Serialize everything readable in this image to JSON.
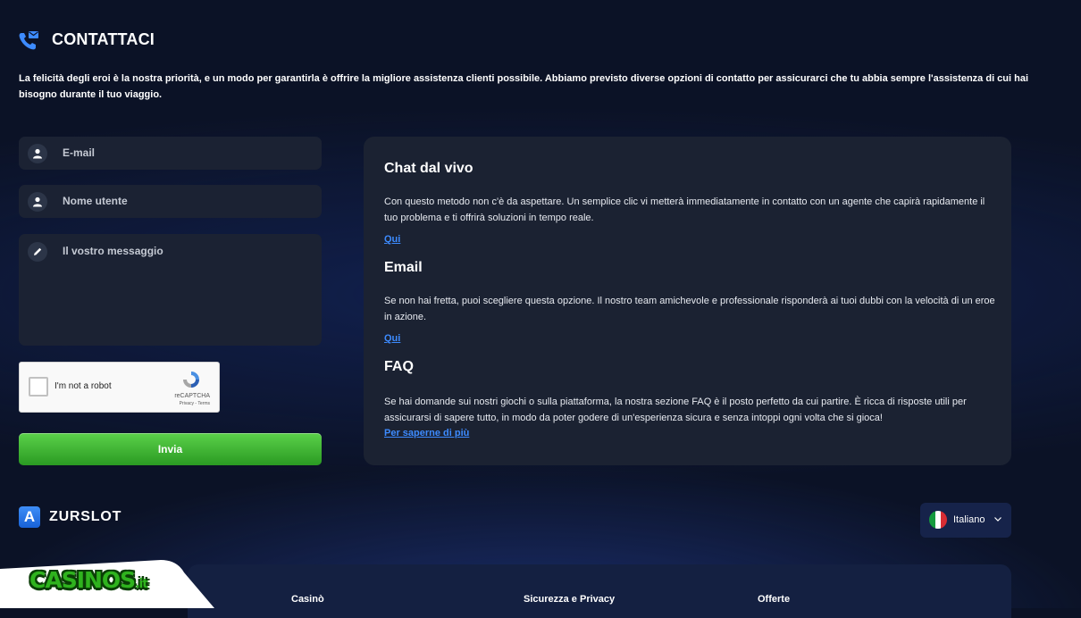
{
  "header": {
    "title": "CONTATTACI",
    "icon": "phone-mail-icon",
    "intro": "La felicità degli eroi è la nostra priorità, e un modo per garantirla è offrire la migliore assistenza clienti possibile. Abbiamo previsto diverse opzioni di contatto per assicurarci che tu abbia sempre l'assistenza di cui hai bisogno durante il tuo viaggio."
  },
  "form": {
    "email_placeholder": "E-mail",
    "username_placeholder": "Nome utente",
    "message_placeholder": "Il vostro messaggio",
    "captcha": {
      "label": "I'm not a robot",
      "brand": "reCAPTCHA",
      "links": "Privacy - Terms"
    },
    "submit_label": "Invia"
  },
  "contact_options": [
    {
      "title": "Chat dal vivo",
      "description": "Con questo metodo non c'è da aspettare. Un semplice clic vi metterà immediatamente in contatto con un agente che capirà rapidamente il tuo problema e ti offrirà soluzioni in tempo reale.",
      "link": "Qui"
    },
    {
      "title": "Email",
      "description": "Se non hai fretta, puoi scegliere questa opzione. Il nostro team amichevole e professionale risponderà ai tuoi dubbi con la velocità di un eroe in azione.",
      "link": "Qui"
    },
    {
      "title": "FAQ",
      "description": "Se hai domande sui nostri giochi o sulla piattaforma, la nostra sezione FAQ è il posto perfetto da cui partire. È ricca di risposte utili per assicurarsi di sapere tutto, in modo da poter godere di un'esperienza sicura e senza intoppi ogni volta che si gioca!",
      "link": "Per saperne di più"
    }
  ],
  "footer": {
    "brand_letter": "A",
    "brand_name": "ZURSLOT",
    "language": "Italiano",
    "columns": [
      "Casinò",
      "Sicurezza e Privacy",
      "Offerte"
    ]
  },
  "watermark": {
    "name": "CASINOS",
    "tld": ".it"
  },
  "colors": {
    "background": "#0b1226",
    "panel": "#1b2232",
    "link": "#3d8bff",
    "submit": "#3fb532",
    "brand_blue": "#2a7de8"
  }
}
